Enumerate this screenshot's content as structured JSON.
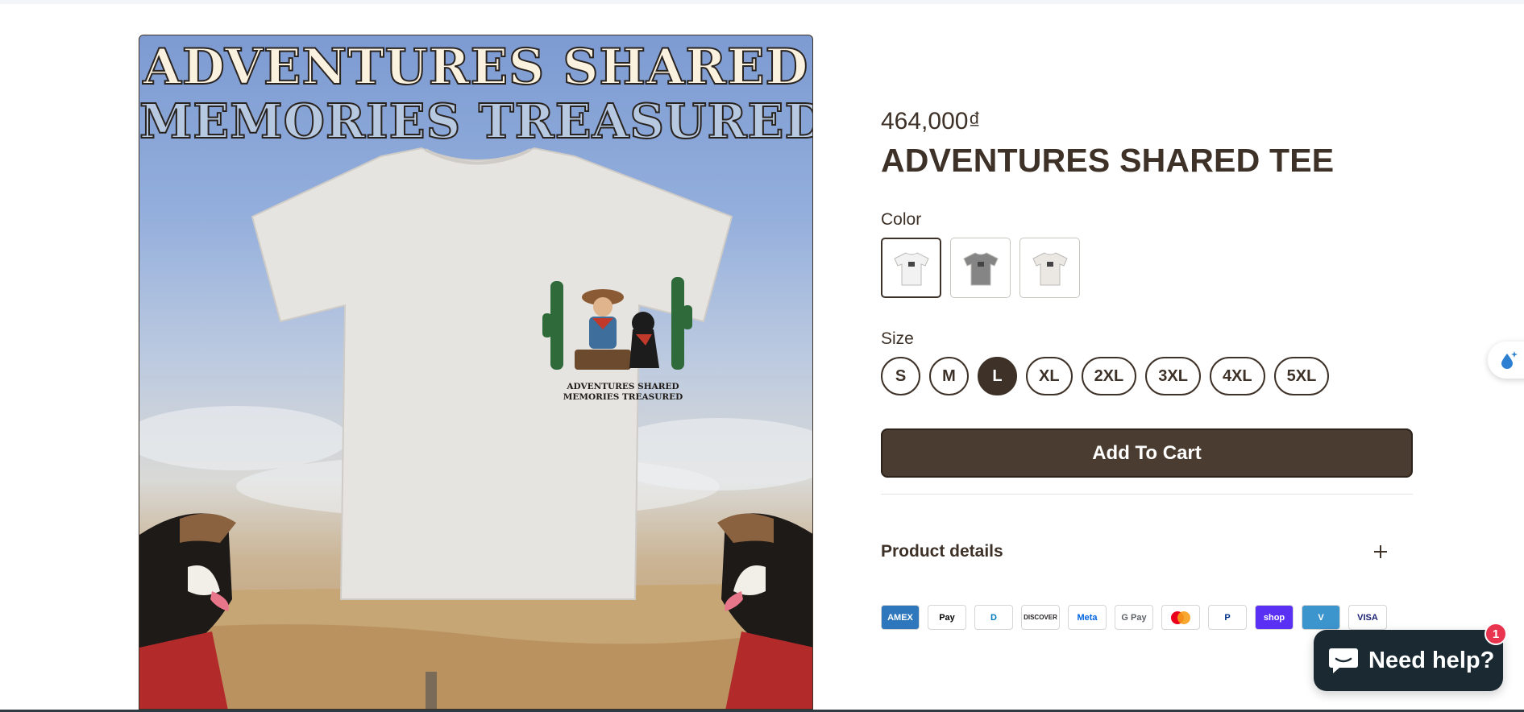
{
  "product": {
    "price": "464,000₫",
    "title": "ADVENTURES SHARED TEE"
  },
  "media": {
    "headline_line1": "ADVENTURES SHARED",
    "headline_line2": "MEMORIES TREASURED",
    "tee_caption_line1": "ADVENTURES SHARED",
    "tee_caption_line2": "MEMORIES TREASURED"
  },
  "options": {
    "color_label": "Color",
    "colors": [
      {
        "name": "White",
        "hex": "#f2f2f2",
        "selected": true
      },
      {
        "name": "Gray",
        "hex": "#858585",
        "selected": false
      },
      {
        "name": "Cream",
        "hex": "#ebe8e4",
        "selected": false
      }
    ],
    "size_label": "Size",
    "sizes": [
      "S",
      "M",
      "L",
      "XL",
      "2XL",
      "3XL",
      "4XL",
      "5XL"
    ],
    "selected_size": "L"
  },
  "cart": {
    "add_to_cart_label": "Add To Cart"
  },
  "details": {
    "label": "Product details"
  },
  "payments": [
    {
      "name": "American Express",
      "label": "AMEX",
      "bg": "#2e77bc",
      "fg": "#ffffff"
    },
    {
      "name": "Apple Pay",
      "label": "Pay",
      "bg": "#ffffff",
      "fg": "#000000"
    },
    {
      "name": "Diners Club",
      "label": "D",
      "bg": "#ffffff",
      "fg": "#0079be"
    },
    {
      "name": "Discover",
      "label": "DISCOVER",
      "bg": "#ffffff",
      "fg": "#231f20"
    },
    {
      "name": "Meta Pay",
      "label": "Meta",
      "bg": "#ffffff",
      "fg": "#0064e0"
    },
    {
      "name": "Google Pay",
      "label": "G Pay",
      "bg": "#ffffff",
      "fg": "#5f6368"
    },
    {
      "name": "Mastercard",
      "label": "",
      "bg": "#ffffff",
      "fg": "#eb001b"
    },
    {
      "name": "PayPal",
      "label": "P",
      "bg": "#ffffff",
      "fg": "#003087"
    },
    {
      "name": "Shop Pay",
      "label": "shop",
      "bg": "#5a31f4",
      "fg": "#ffffff"
    },
    {
      "name": "Venmo",
      "label": "V",
      "bg": "#3d95ce",
      "fg": "#ffffff"
    },
    {
      "name": "Visa",
      "label": "VISA",
      "bg": "#ffffff",
      "fg": "#1a1f71"
    }
  ],
  "chat": {
    "label": "Need help?",
    "badge_count": "1"
  },
  "colors": {
    "brand_dark": "#3d3128",
    "button_bg": "#4a3c30",
    "chat_bg": "#1b2a32",
    "badge_red": "#e8344f"
  }
}
